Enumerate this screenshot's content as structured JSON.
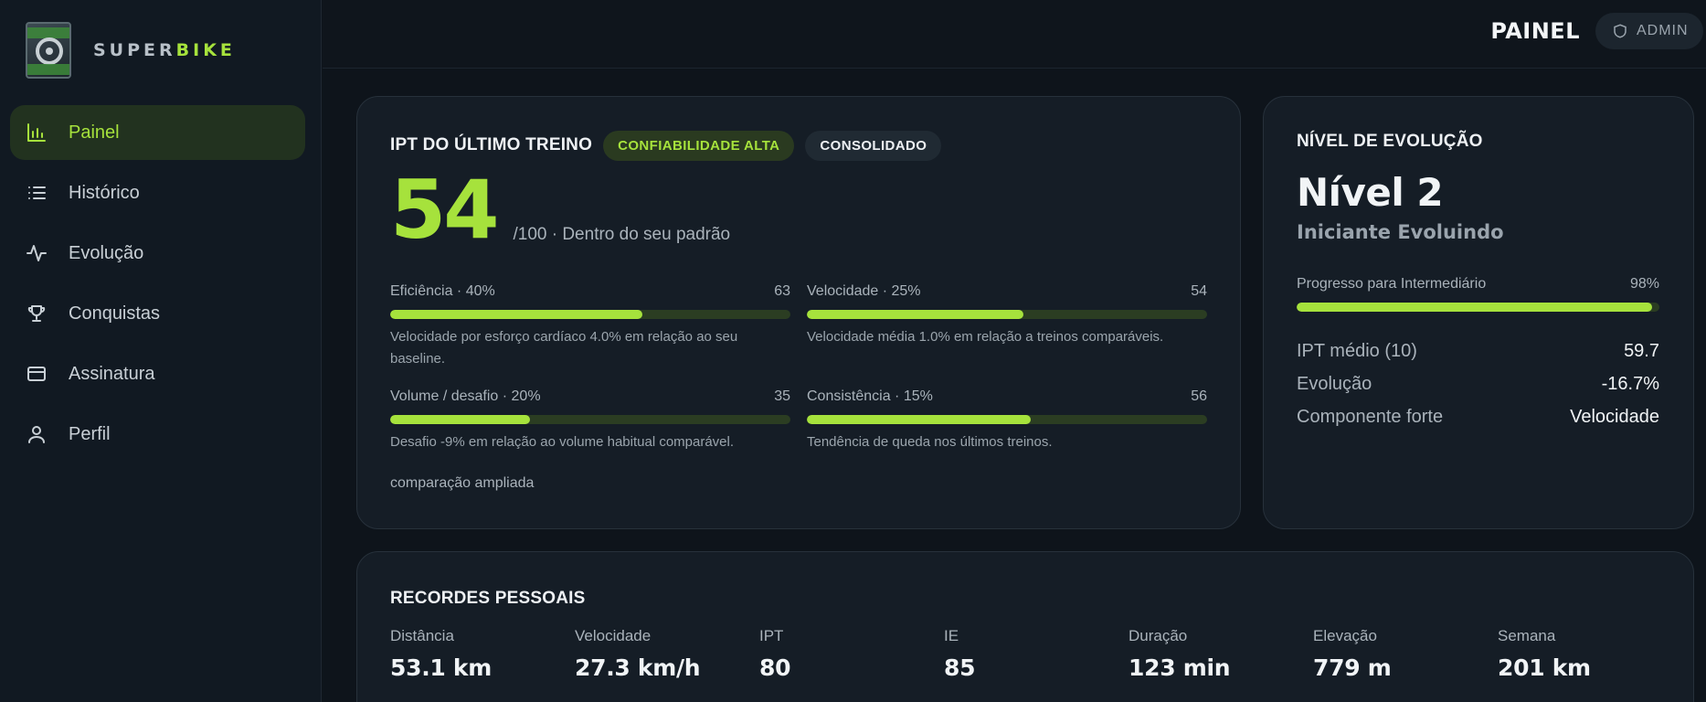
{
  "brand": {
    "name_a": "SUPER",
    "name_b": "BIKE",
    "logo_icon": "superbike-logo"
  },
  "sidebar": {
    "items": [
      {
        "label": "Painel",
        "icon": "bar-chart-icon",
        "active": true
      },
      {
        "label": "Histórico",
        "icon": "list-icon"
      },
      {
        "label": "Evolução",
        "icon": "activity-icon"
      },
      {
        "label": "Conquistas",
        "icon": "trophy-icon"
      },
      {
        "label": "Assinatura",
        "icon": "credit-card-icon"
      },
      {
        "label": "Perfil",
        "icon": "user-icon"
      }
    ]
  },
  "header": {
    "title": "PAINEL",
    "role": "ADMIN",
    "role_icon": "shield-icon"
  },
  "ipt": {
    "title": "IPT DO ÚLTIMO TREINO",
    "badge_confidence": "CONFIABILIDADE ALTA",
    "badge_status": "CONSOLIDADO",
    "score": "54",
    "score_sub": "/100 · Dentro do seu padrão",
    "metrics": [
      {
        "label": "Eficiência · 40%",
        "value": "63",
        "fill": 0.63,
        "desc": "Velocidade por esforço cardíaco 4.0% em relação ao seu baseline."
      },
      {
        "label": "Velocidade · 25%",
        "value": "54",
        "fill": 0.54,
        "desc": "Velocidade média 1.0% em relação a treinos comparáveis."
      },
      {
        "label": "Volume / desafio · 20%",
        "value": "35",
        "fill": 0.35,
        "desc": "Desafio -9% em relação ao volume habitual comparável."
      },
      {
        "label": "Consistência · 15%",
        "value": "56",
        "fill": 0.56,
        "desc": "Tendência de queda nos últimos treinos."
      }
    ],
    "compare_link": "comparação ampliada"
  },
  "level": {
    "title": "NÍVEL DE EVOLUÇÃO",
    "name": "Nível 2",
    "subtitle": "Iniciante Evoluindo",
    "progress_label": "Progresso para Intermediário",
    "progress_value": "98%",
    "progress_fill": 0.98,
    "stats": [
      {
        "label": "IPT médio (10)",
        "value": "59.7"
      },
      {
        "label": "Evolução",
        "value": "-16.7%"
      },
      {
        "label": "Componente forte",
        "value": "Velocidade"
      }
    ]
  },
  "records": {
    "title": "RECORDES PESSOAIS",
    "items": [
      {
        "label": "Distância",
        "value": "53.1 km"
      },
      {
        "label": "Velocidade",
        "value": "27.3 km/h"
      },
      {
        "label": "IPT",
        "value": "80"
      },
      {
        "label": "IE",
        "value": "85"
      },
      {
        "label": "Duração",
        "value": "123 min"
      },
      {
        "label": "Elevação",
        "value": "779 m"
      },
      {
        "label": "Semana",
        "value": "201 km"
      }
    ]
  },
  "colors": {
    "accent": "#a6e23c",
    "background": "#0e141b",
    "card": "#151d26"
  }
}
